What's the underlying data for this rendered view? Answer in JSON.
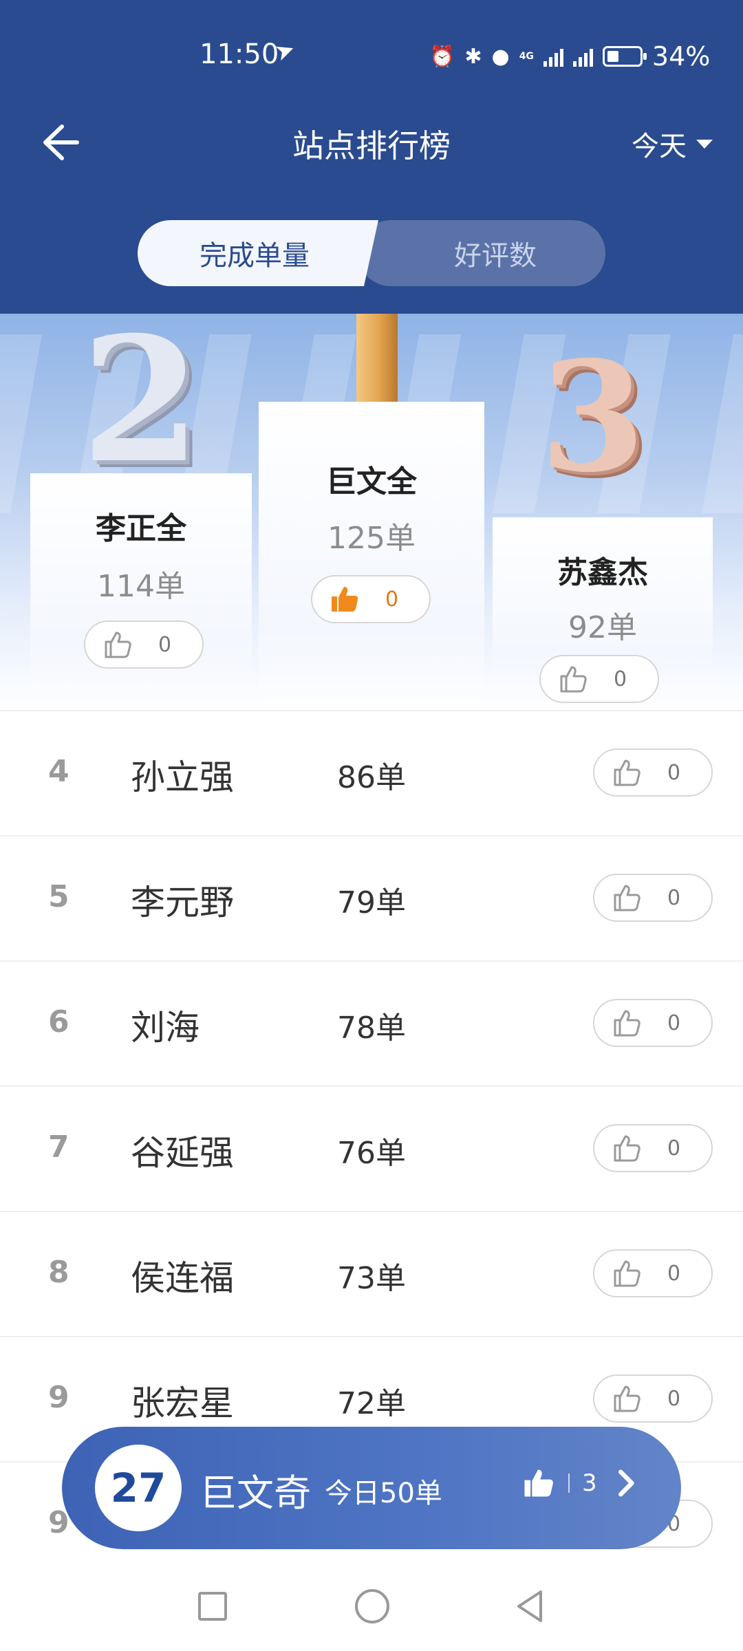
{
  "status_bar": {
    "time": "11:50",
    "battery": "34%",
    "network_4g": "4G"
  },
  "header": {
    "title": "站点排行榜",
    "date_filter": "今天"
  },
  "tabs": [
    {
      "label": "完成单量",
      "active": true
    },
    {
      "label": "好评数",
      "active": false
    }
  ],
  "podium": {
    "first": {
      "rank_mark": "1",
      "name": "巨文全",
      "count": "125单",
      "likes": "0"
    },
    "second": {
      "rank_mark": "2",
      "name": "李正全",
      "count": "114单",
      "likes": "0"
    },
    "third": {
      "rank_mark": "3",
      "name": "苏鑫杰",
      "count": "92单",
      "likes": "0"
    }
  },
  "list": [
    {
      "rank": "4",
      "name": "孙立强",
      "count": "86单",
      "likes": "0"
    },
    {
      "rank": "5",
      "name": "李元野",
      "count": "79单",
      "likes": "0"
    },
    {
      "rank": "6",
      "name": "刘海",
      "count": "78单",
      "likes": "0"
    },
    {
      "rank": "7",
      "name": "谷延强",
      "count": "76单",
      "likes": "0"
    },
    {
      "rank": "8",
      "name": "侯连福",
      "count": "73单",
      "likes": "0"
    },
    {
      "rank": "9",
      "name": "张宏星",
      "count": "72单",
      "likes": "0"
    },
    {
      "rank": "9",
      "name": "",
      "count": "",
      "likes": "0"
    }
  ],
  "my_rank": {
    "rank": "27",
    "name": "巨文奇",
    "count": "今日50单",
    "likes": "3"
  },
  "colors": {
    "header_bg": "#2a4b8f",
    "accent_gold": "#e07a13",
    "my_bar": "#4f75c4"
  }
}
